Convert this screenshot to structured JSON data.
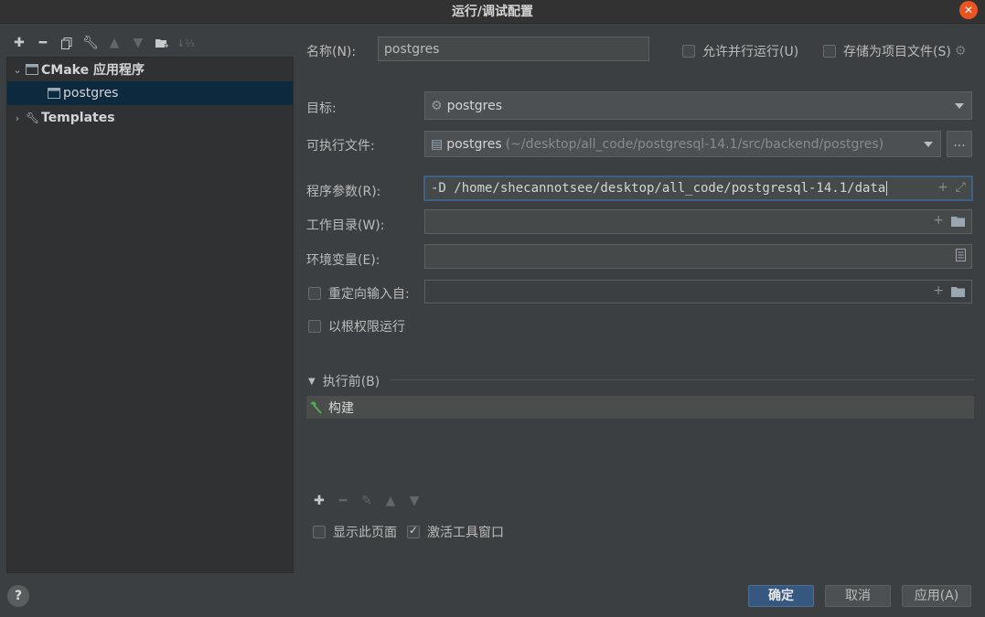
{
  "window": {
    "title": "运行/调试配置"
  },
  "tree": {
    "groups": [
      {
        "label": "CMake 应用程序",
        "children": [
          {
            "label": "postgres"
          }
        ]
      },
      {
        "label": "Templates"
      }
    ]
  },
  "form": {
    "name_label": "名称(N):",
    "name_value": "postgres",
    "allow_parallel_label": "允许并行运行(U)",
    "store_as_project_label": "存储为项目文件(S)",
    "target_label": "目标:",
    "target_value": "postgres",
    "executable_label": "可执行文件:",
    "executable_value": "postgres",
    "executable_path": "(~/desktop/all_code/postgresql-14.1/src/backend/postgres)",
    "browse_label": "...",
    "program_args_label": "程序参数(R):",
    "program_args_value": "-D /home/shecannotsee/desktop/all_code/postgresql-14.1/data",
    "working_dir_label": "工作目录(W):",
    "working_dir_value": "",
    "env_label": "环境变量(E):",
    "env_value": "",
    "redirect_label": "重定向输入自:",
    "redirect_value": "",
    "root_label": "以根权限运行"
  },
  "before_launch": {
    "title": "执行前(B)",
    "items": [
      {
        "label": "构建"
      }
    ],
    "show_page_label": "显示此页面",
    "activate_tool_window_label": "激活工具窗口"
  },
  "buttons": {
    "ok": "确定",
    "cancel": "取消",
    "apply": "应用(A)",
    "help": "?"
  },
  "colors": {
    "accent": "#365880",
    "selection": "#0d293e",
    "build_icon": "#4caf50"
  }
}
